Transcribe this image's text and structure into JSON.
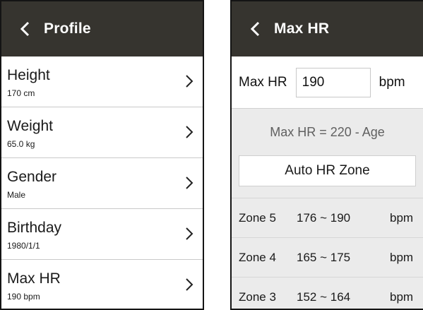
{
  "profile": {
    "title": "Profile",
    "items": [
      {
        "label": "Height",
        "value": "170 cm"
      },
      {
        "label": "Weight",
        "value": "65.0 kg"
      },
      {
        "label": "Gender",
        "value": "Male"
      },
      {
        "label": "Birthday",
        "value": "1980/1/1"
      },
      {
        "label": "Max HR",
        "value": "190 bpm"
      }
    ]
  },
  "maxhr": {
    "title": "Max HR",
    "field_label": "Max HR",
    "field_value": "190",
    "field_unit": "bpm",
    "formula": "Max HR = 220 - Age",
    "auto_button": "Auto HR Zone",
    "zones": [
      {
        "name": "Zone 5",
        "range": "176 ~ 190",
        "unit": "bpm"
      },
      {
        "name": "Zone 4",
        "range": "165 ~ 175",
        "unit": "bpm"
      },
      {
        "name": "Zone 3",
        "range": "152 ~ 164",
        "unit": "bpm"
      }
    ]
  },
  "colors": {
    "appbar": "#36342f",
    "panel": "#ebebeb",
    "divider": "#c9c9c9"
  },
  "icons": {
    "back": "chevron-left-icon",
    "row": "chevron-right-icon"
  }
}
